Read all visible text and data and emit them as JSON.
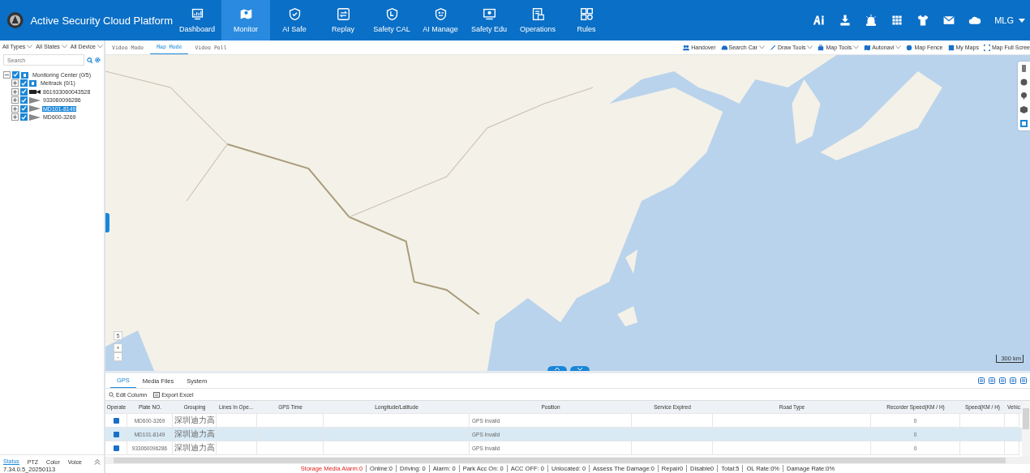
{
  "header": {
    "title": "Active Security Cloud Platform",
    "user": "MLG",
    "nav": [
      {
        "label": "Dashboard",
        "selected": false
      },
      {
        "label": "Monitor",
        "selected": true
      },
      {
        "label": "AI Safe",
        "selected": false
      },
      {
        "label": "Replay",
        "selected": false
      },
      {
        "label": "Safety CAL",
        "selected": false
      },
      {
        "label": "AI Manage",
        "selected": false
      },
      {
        "label": "Safety Edu",
        "selected": false
      },
      {
        "label": "Operations",
        "selected": false
      },
      {
        "label": "Rules",
        "selected": false
      }
    ]
  },
  "filters": [
    "All Types",
    "All States",
    "All Device"
  ],
  "search": {
    "placeholder": "Search"
  },
  "tree": [
    {
      "label": "Monitoring Center",
      "count": "(0/5)",
      "kind": "group",
      "checked": true,
      "expanded": true,
      "selected": false,
      "children": [
        {
          "label": "Meitrack",
          "count": "(0/1)",
          "kind": "group",
          "checked": true,
          "expanded": false,
          "selected": false
        },
        {
          "label": "861933060043528",
          "kind": "camera",
          "checked": true,
          "expanded": false,
          "selected": false
        },
        {
          "label": "933060096286",
          "kind": "vehicle",
          "checked": true,
          "expanded": false,
          "selected": false
        },
        {
          "label": "MD101-8149",
          "kind": "vehicle",
          "checked": true,
          "expanded": false,
          "selected": true
        },
        {
          "label": "MD600-3269",
          "kind": "vehicle",
          "checked": true,
          "expanded": false,
          "selected": false
        }
      ]
    }
  ],
  "left_tabs": [
    {
      "label": "Status",
      "selected": true
    },
    {
      "label": "PTZ",
      "selected": false
    },
    {
      "label": "Color",
      "selected": false
    },
    {
      "label": "Voice",
      "selected": false
    }
  ],
  "version": "7.34.0.5_20250113",
  "map_tabs": [
    {
      "label": "Video Mode",
      "selected": false
    },
    {
      "label": "Map Mode",
      "selected": true
    },
    {
      "label": "Video Poll",
      "selected": false
    }
  ],
  "map_tools": [
    {
      "label": "Handover",
      "dropdown": false
    },
    {
      "label": "Search Car",
      "dropdown": true
    },
    {
      "label": "Draw Tools",
      "dropdown": true
    },
    {
      "label": "Map Tools",
      "dropdown": true
    },
    {
      "label": "Autonavi",
      "dropdown": true
    },
    {
      "label": "Map Fence",
      "dropdown": false
    },
    {
      "label": "My Maps",
      "dropdown": false
    },
    {
      "label": "Map Full Scree",
      "dropdown": false
    }
  ],
  "map": {
    "zoom": "5",
    "zoom_in": "+",
    "zoom_out": "-",
    "scale": "300 km"
  },
  "bottom_tabs": [
    {
      "label": "GPS",
      "selected": true
    },
    {
      "label": "Media Files",
      "selected": false
    },
    {
      "label": "System",
      "selected": false
    }
  ],
  "table_tools": [
    "Edit Column",
    "Export Excel"
  ],
  "table": {
    "columns": [
      "Operate",
      "Plate NO.",
      "Grouping",
      "Lines In Ope...",
      "GPS Time",
      "Longitude/Latitude",
      "Position",
      "Service Expired",
      "Road Type",
      "Recorder Speed(KM / H)",
      "Speed(KM / H)",
      "Vehic"
    ],
    "rows": [
      {
        "selected": false,
        "cells": [
          "",
          "MD600-3269",
          "深圳迪力高",
          "",
          "",
          "",
          "GPS Invalid",
          "",
          "",
          "0",
          "",
          ""
        ]
      },
      {
        "selected": true,
        "cells": [
          "",
          "MD101-8149",
          "深圳迪力高",
          "",
          "",
          "",
          "GPS Invalid",
          "",
          "",
          "0",
          "",
          ""
        ]
      },
      {
        "selected": false,
        "cells": [
          "",
          "933060096286",
          "深圳迪力高",
          "",
          "",
          "",
          "GPS Invalid",
          "",
          "",
          "0",
          "",
          ""
        ]
      }
    ]
  },
  "status_items": [
    {
      "label": "Storage Media Alarm:0",
      "alert": true
    },
    {
      "label": "Online:0",
      "alert": false
    },
    {
      "label": "Driving: 0",
      "alert": false
    },
    {
      "label": "Alarm: 0",
      "alert": false
    },
    {
      "label": "Park Acc On: 0",
      "alert": false
    },
    {
      "label": "ACC OFF: 0",
      "alert": false
    },
    {
      "label": "Unlocated: 0",
      "alert": false
    },
    {
      "label": "Assess The Damage:0",
      "alert": false
    },
    {
      "label": "Repair0",
      "alert": false
    },
    {
      "label": "Disable0",
      "alert": false
    },
    {
      "label": "Total:5",
      "alert": false
    },
    {
      "label": "OL Rate:0%",
      "alert": false
    },
    {
      "label": "Damage Rate:0%",
      "alert": false
    }
  ]
}
